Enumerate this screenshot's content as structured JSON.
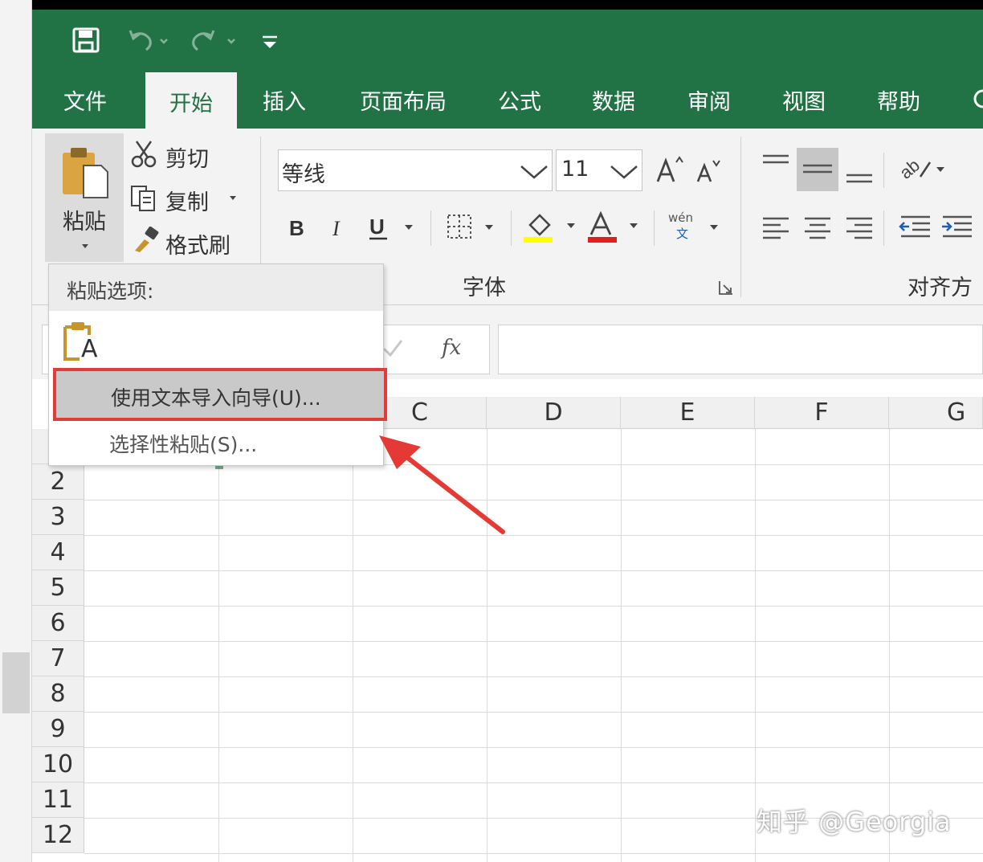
{
  "app": {
    "theme_color": "#217346"
  },
  "tabs": [
    {
      "label": "文件",
      "active": false
    },
    {
      "label": "开始",
      "active": true
    },
    {
      "label": "插入",
      "active": false
    },
    {
      "label": "页面布局",
      "active": false
    },
    {
      "label": "公式",
      "active": false
    },
    {
      "label": "数据",
      "active": false
    },
    {
      "label": "审阅",
      "active": false
    },
    {
      "label": "视图",
      "active": false
    },
    {
      "label": "帮助",
      "active": false
    }
  ],
  "clipboard": {
    "paste": "粘贴",
    "cut": "剪切",
    "copy": "复制",
    "format_painter": "格式刷"
  },
  "font": {
    "font_name": "等线",
    "font_size": "11",
    "group_label": "字体",
    "phonetic_top": "wén",
    "phonetic_bottom": "文"
  },
  "alignment": {
    "group_label": "对齐方式"
  },
  "formula_bar": {
    "fx": "fx"
  },
  "paste_menu": {
    "header": "粘贴选项:",
    "icon_letter": "A",
    "items": [
      "使用文本导入向导(U)...",
      "选择性粘贴(S)..."
    ]
  },
  "columns": [
    "C",
    "D",
    "E",
    "F",
    "G"
  ],
  "rows": [
    "2",
    "3",
    "4",
    "5",
    "6",
    "7",
    "8",
    "9",
    "10",
    "11",
    "12"
  ],
  "watermark": "知乎 @Georgia"
}
